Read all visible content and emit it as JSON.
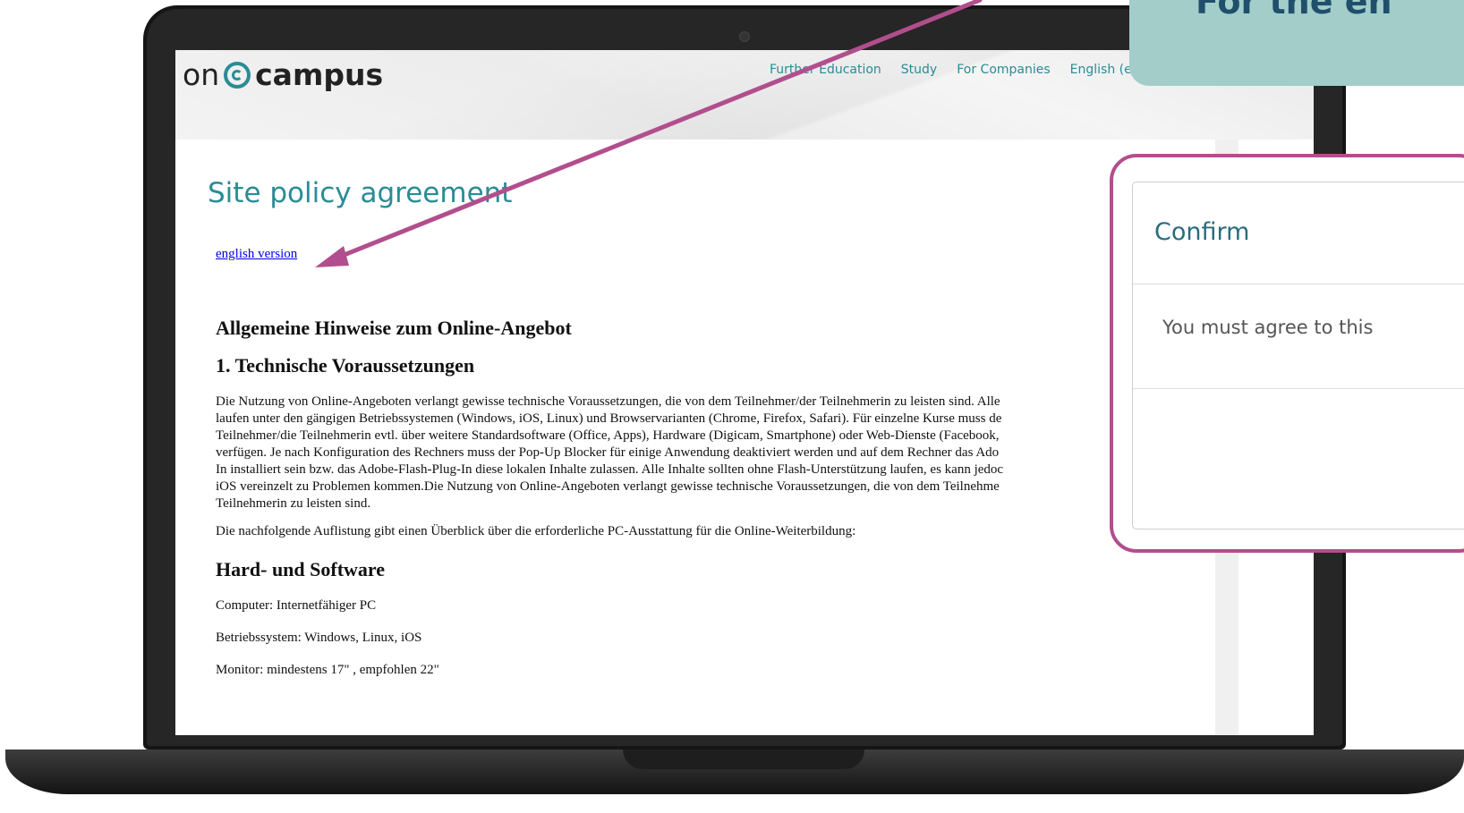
{
  "site": {
    "logo_on": "on",
    "logo_campus": "campus",
    "nav": [
      "Further Education",
      "Study",
      "For Companies",
      "English (e"
    ]
  },
  "page": {
    "title": "Site policy agreement",
    "english_link": "english version",
    "heading_main": "Allgemeine Hinweise zum Online-Angebot",
    "heading_tech": "1. Technische Voraussetzungen",
    "lines": [
      "Die Nutzung von Online-Angeboten verlangt gewisse technische Voraussetzungen, die von dem Teilnehmer/der Teilnehmerin zu leisten sind. Alle",
      "laufen unter den gängigen Betriebssystemen (Windows, iOS, Linux) und Browservarianten (Chrome, Firefox, Safari). Für einzelne Kurse muss de",
      "Teilnehmer/die Teilnehmerin evtl. über weitere Standardsoftware (Office, Apps), Hardware (Digicam, Smartphone) oder Web-Dienste (Facebook,",
      "verfügen. Je nach Konfiguration des Rechners muss der Pop-Up Blocker für einige Anwendung deaktiviert werden und auf dem Rechner das Ado",
      "In installiert sein bzw. das Adobe-Flash-Plug-In diese lokalen Inhalte zulassen. Alle Inhalte sollten ohne Flash-Unterstützung laufen, es kann jedoc",
      "iOS vereinzelt zu Problemen kommen.Die Nutzung von Online-Angeboten verlangt gewisse technische Voraussetzungen, die von dem Teilnehme",
      "Teilnehmerin zu leisten sind."
    ],
    "overview": "Die nachfolgende Auflistung gibt einen Überblick über die erforderliche PC-Ausstattung für die Online-Weiterbildung:",
    "heading_hw": "Hard- und Software",
    "computer": "Computer: Internetfähiger PC",
    "os": "Betriebssystem: Windows, Linux, iOS",
    "monitor": "Monitor: mindestens 17\" , empfohlen 22\""
  },
  "callout": {
    "text": "For the en"
  },
  "dialog": {
    "title": "Confirm",
    "body": "You must agree to this"
  },
  "colors": {
    "accent_teal": "#2a8c95",
    "highlight_magenta": "#b24e8d",
    "callout_bg": "#a3cdc9",
    "callout_text": "#1f4f6b"
  }
}
